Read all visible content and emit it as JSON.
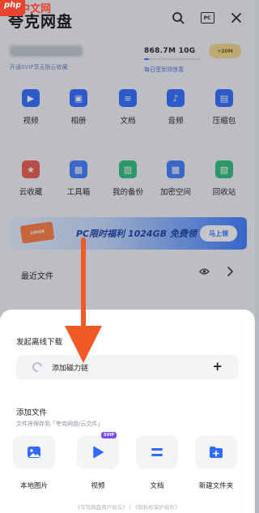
{
  "app": {
    "title": "夸克网盘",
    "icons": [
      "search-icon",
      "pc-icon",
      "close-icon"
    ],
    "pc_icon_text": "PC"
  },
  "user": {
    "vip_hint": "开通SVIP享无限云收藏",
    "storage": "868.7M  10G",
    "storage_used_fraction": 0.09,
    "checkin": "每日签到领惊喜",
    "gift_badge": "+20M"
  },
  "shortcuts": [
    {
      "label": "视频",
      "sub": "",
      "icon": "video-icon",
      "color": "#2f6bff"
    },
    {
      "label": "相册",
      "sub": "",
      "icon": "image-icon",
      "color": "#2f6bff"
    },
    {
      "label": "文档",
      "sub": "",
      "icon": "doc-icon",
      "color": "#2f6bff"
    },
    {
      "label": "音频",
      "sub": "",
      "icon": "music-icon",
      "color": "#2f6bff"
    },
    {
      "label": "压缩包",
      "sub": "",
      "icon": "zip-icon",
      "color": "#2f6bff"
    },
    {
      "label": "云收藏",
      "sub": "",
      "icon": "favorite-icon",
      "color": "#ef5a4c"
    },
    {
      "label": "工具箱",
      "sub": "",
      "icon": "toolbox-icon",
      "color": "#3f7cff"
    },
    {
      "label": "我的备份",
      "sub": "",
      "icon": "backup-icon",
      "color": "#2ebf7a"
    },
    {
      "label": "加密空间",
      "sub": "",
      "icon": "lock-icon",
      "color": "#3f7cff"
    },
    {
      "label": "回收站",
      "sub": "",
      "icon": "trash-icon",
      "color": "#2ebf7a"
    }
  ],
  "banner": {
    "ticket": "100GB",
    "text": "PC限时福利 1024GB 免费领",
    "button": "马上领"
  },
  "recent": {
    "label": "最近文件"
  },
  "sheet": {
    "offline_title": "发起离线下载",
    "magnet_label": "添加磁力链",
    "magnet_plus": "+",
    "add_file_title": "添加文件",
    "add_file_sub": "文件将保存到「夸克网盘/云文件」",
    "tiles": [
      {
        "label": "本地图片",
        "icon": "photo-icon",
        "badge": ""
      },
      {
        "label": "视频",
        "icon": "play-icon",
        "badge": "SVIP"
      },
      {
        "label": "文档",
        "icon": "document-icon",
        "badge": ""
      },
      {
        "label": "新建文件夹",
        "icon": "new-folder-icon",
        "badge": ""
      }
    ],
    "footer": "《夸克网盘用户协议》 | 《隐私权保护指引》"
  },
  "watermark": {
    "logo": "php",
    "text": "中文网"
  },
  "colors": {
    "accent": "#2f6bff",
    "arrow": "#f05a24",
    "sheet_bg": "#ffffff"
  }
}
